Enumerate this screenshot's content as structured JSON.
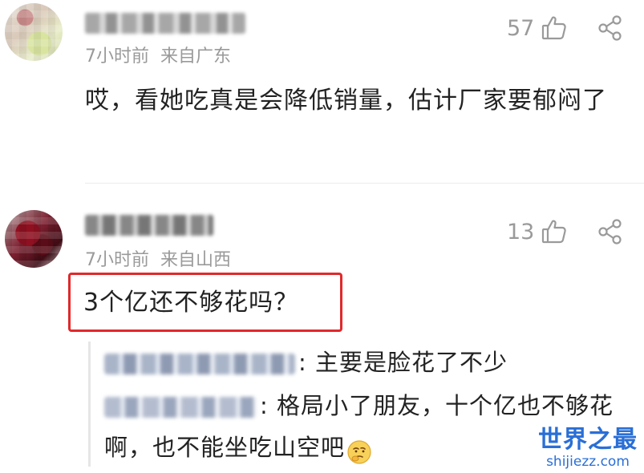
{
  "comments": [
    {
      "time": "7小时前",
      "location": "来自广东",
      "likes": "57",
      "text": "哎，看她吃真是会降低销量，估计厂家要郁闷了"
    },
    {
      "time": "7小时前",
      "location": "来自山西",
      "likes": "13",
      "text": "3个亿还不够花吗？",
      "highlight_color": "#e0292b",
      "replies": [
        {
          "text": ": 主要是脸花了不少"
        },
        {
          "text": ": 格局小了朋友，十个亿也不够花啊，也不能坐吃山空吧",
          "emoji": "thinking-face-emoji"
        }
      ]
    }
  ],
  "watermark": {
    "title": "世界之最",
    "url": "shijiezz.com"
  },
  "colors": {
    "meta_text": "#9a9a9a",
    "body_text": "#222222",
    "highlight": "#e0292b",
    "watermark": "#2a6fd6"
  }
}
